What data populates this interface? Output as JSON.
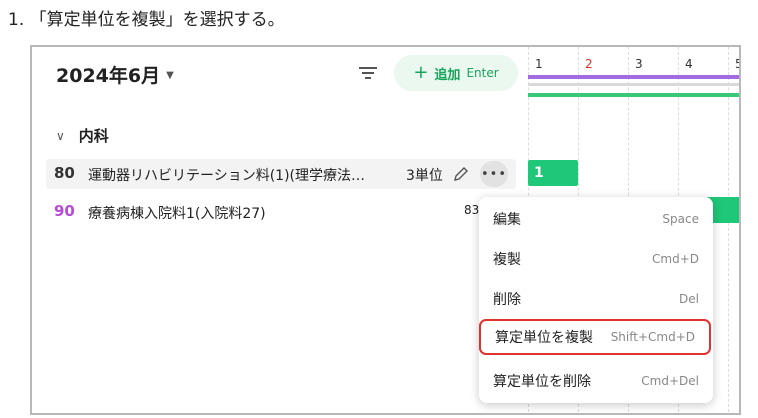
{
  "instruction": "1. 「算定単位を複製」を選択する。",
  "header": {
    "month": "2024年6月",
    "add_label": "追加",
    "add_shortcut": "Enter"
  },
  "timeline": {
    "days": [
      "1",
      "2",
      "3",
      "4",
      "5"
    ],
    "today_color": "#d9302c"
  },
  "section": {
    "title": "内科"
  },
  "rows": [
    {
      "code": "80",
      "name": "運動器リハビリテーション料(1)(理学療法…",
      "units": "3単位",
      "bar_label": "1",
      "code_color": "#333333"
    },
    {
      "code": "90",
      "name": "療養病棟入院料1(入院料27)",
      "units": "83",
      "code_color": "#b94ad6"
    }
  ],
  "menu": {
    "items": [
      {
        "label": "編集",
        "shortcut": "Space"
      },
      {
        "label": "複製",
        "shortcut": "Cmd+D"
      },
      {
        "label": "削除",
        "shortcut": "Del"
      },
      {
        "label": "算定単位を複製",
        "shortcut": "Shift+Cmd+D",
        "highlighted": true
      },
      {
        "label": "算定単位を削除",
        "shortcut": "Cmd+Del"
      }
    ]
  },
  "colors": {
    "accent_green": "#1aa35a",
    "bar_green": "#1fc778",
    "bar_purple": "#a36ae2",
    "highlight_red": "#e0322f"
  },
  "icons": [
    "filter-icon",
    "plus-icon",
    "chevron-down-icon",
    "pencil-icon",
    "more-icon"
  ]
}
